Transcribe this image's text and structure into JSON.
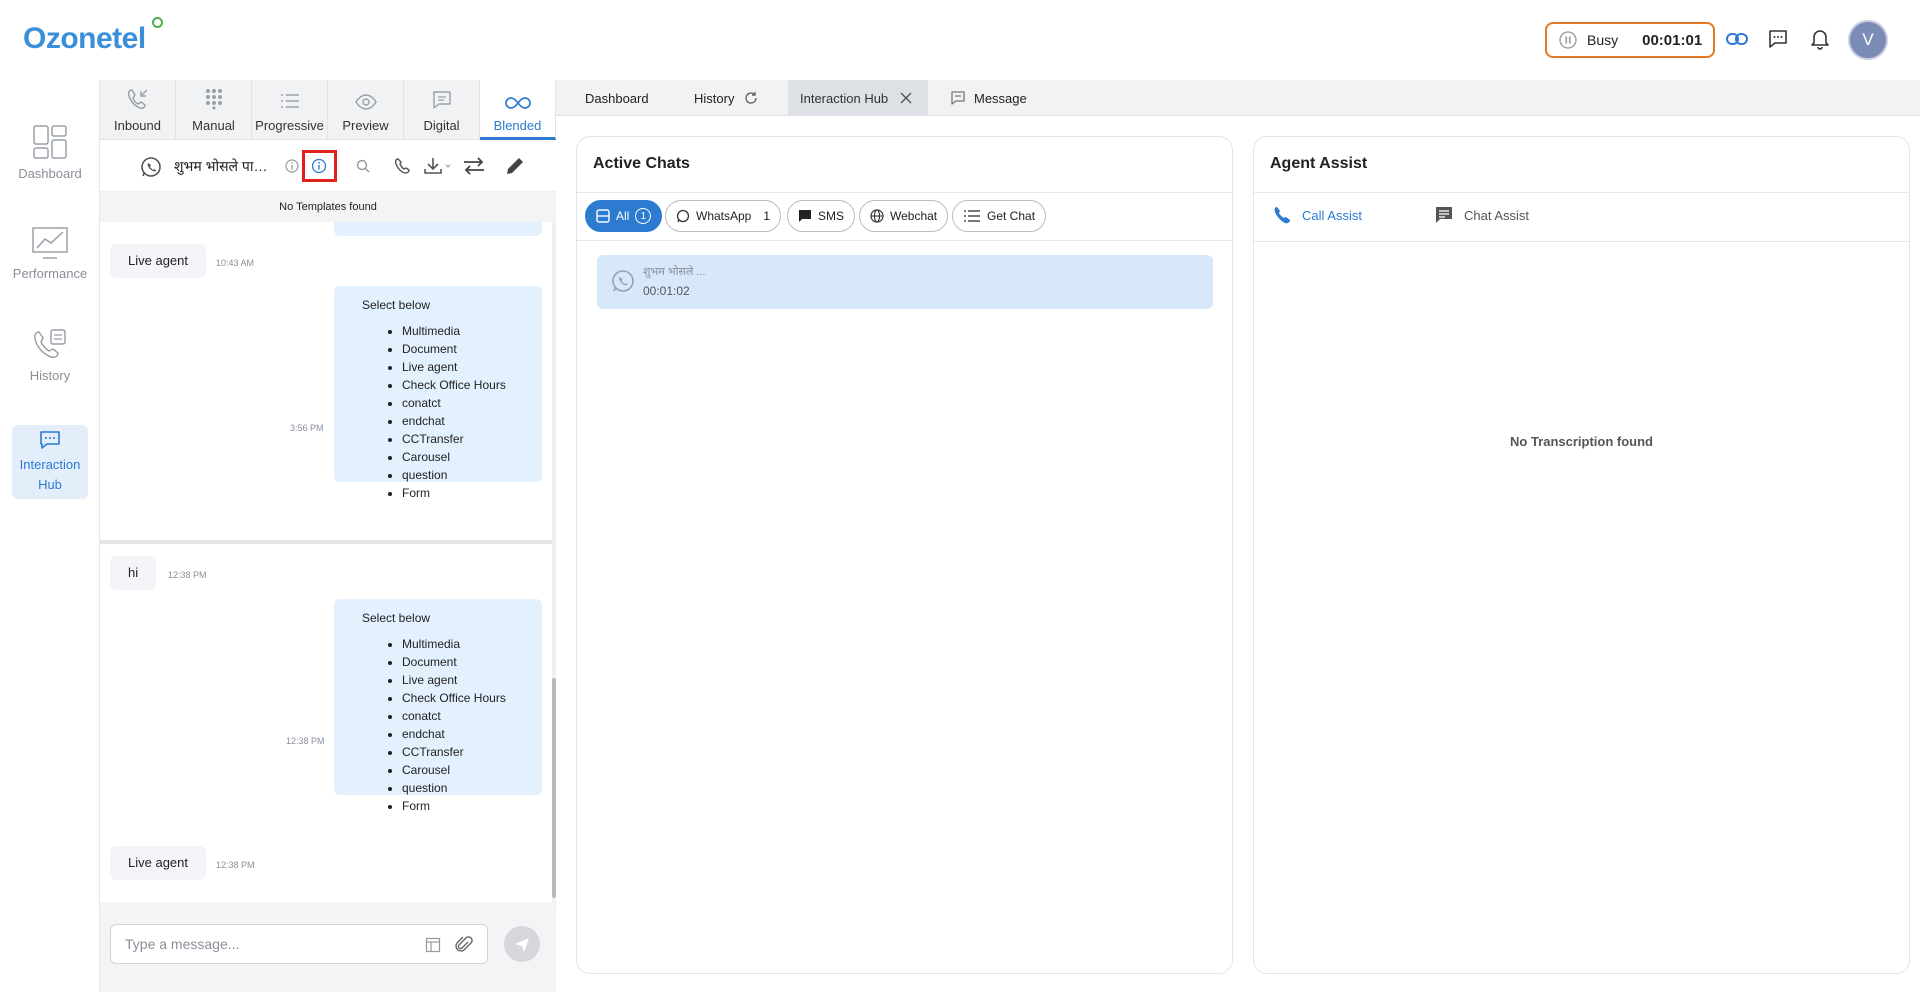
{
  "brand": {
    "logo_text": "Ozonetel"
  },
  "topbar": {
    "status": "Busy",
    "timer": "00:01:01",
    "avatar_initial": "V"
  },
  "leftnav": [
    {
      "label": "Dashboard"
    },
    {
      "label": "Performance"
    },
    {
      "label": "History"
    },
    {
      "label": "Interaction Hub",
      "active": true
    }
  ],
  "dial_tabs": [
    {
      "label": "Inbound"
    },
    {
      "label": "Manual"
    },
    {
      "label": "Progressive"
    },
    {
      "label": "Preview"
    },
    {
      "label": "Digital"
    },
    {
      "label": "Blended",
      "active": true
    }
  ],
  "chat_header": {
    "contact_name": "शुभम भोसले पाटील"
  },
  "templates_notice": "No Templates found",
  "messages": {
    "m1": {
      "text": "Live agent",
      "time": "10:43 AM"
    },
    "m2": {
      "heading": "Select below",
      "time": "3:56 PM",
      "items": [
        "Multimedia",
        "Document",
        "Live agent",
        "Check Office Hours",
        "conatct",
        "endchat",
        "CCTransfer",
        "Carousel",
        "question",
        "Form"
      ]
    },
    "m3": {
      "text": "hi",
      "time": "12:38 PM"
    },
    "m4": {
      "heading": "Select below",
      "time": "12:38 PM",
      "items": [
        "Multimedia",
        "Document",
        "Live agent",
        "Check Office Hours",
        "conatct",
        "endchat",
        "CCTransfer",
        "Carousel",
        "question",
        "Form"
      ]
    },
    "m5": {
      "text": "Live agent",
      "time": "12:38 PM"
    }
  },
  "composer": {
    "placeholder": "Type a message..."
  },
  "work_tabs": [
    {
      "label": "Dashboard"
    },
    {
      "label": "History"
    },
    {
      "label": "Interaction Hub",
      "active": true
    },
    {
      "label": "Message"
    }
  ],
  "active_chats": {
    "title": "Active Chats",
    "filters": [
      {
        "label": "All",
        "count": "1",
        "active": true
      },
      {
        "label": "WhatsApp",
        "count": "1"
      },
      {
        "label": "SMS"
      },
      {
        "label": "Webchat"
      },
      {
        "label": "Get Chat"
      }
    ],
    "chat": {
      "name": "शुभम भोसले ...",
      "duration": "00:01:02"
    }
  },
  "agent_assist": {
    "title": "Agent Assist",
    "tabs": [
      {
        "label": "Call Assist",
        "active": true
      },
      {
        "label": "Chat Assist"
      }
    ],
    "empty": "No Transcription found"
  },
  "colors": {
    "accent": "#2c7bd1",
    "busy_border": "#e07a28",
    "highlight": "#e0201c",
    "bubble_out": "#e3f0fd"
  }
}
